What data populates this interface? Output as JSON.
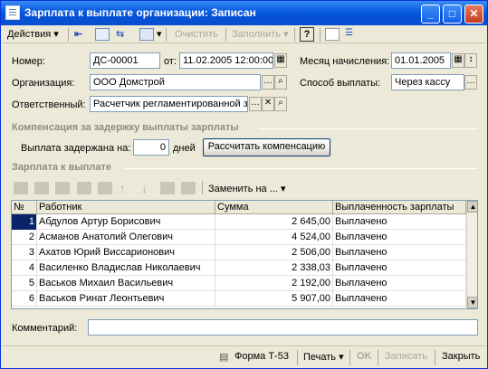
{
  "window": {
    "title": "Зарплата к выплате организации: Записан"
  },
  "toolbar": {
    "actions_label": "Действия",
    "clear_label": "Очистить",
    "fill_label": "Заполнить",
    "help_label": "?"
  },
  "form": {
    "number_label": "Номер:",
    "number_value": "ДС-00001",
    "from_label": "от:",
    "date_value": "11.02.2005 12:00:00",
    "month_label": "Месяц начисления:",
    "month_value": "01.01.2005",
    "org_label": "Организация:",
    "org_value": "ООО Домстрой",
    "payment_label": "Способ выплаты:",
    "payment_value": "Через кассу",
    "responsible_label": "Ответственный:",
    "responsible_value": "Расчетчик регламентированной з"
  },
  "compensation": {
    "section_title": "Компенсация за задержку выплаты зарплаты",
    "delay_label": "Выплата задержана на:",
    "delay_value": "0",
    "days_label": "дней",
    "calc_button": "Рассчитать компенсацию"
  },
  "payout": {
    "section_title": "Зарплата к выплате",
    "replace_label": "Заменить на ...",
    "columns": [
      "№",
      "Работник",
      "Сумма",
      "Выплаченность зарплаты"
    ],
    "rows": [
      {
        "n": "1",
        "worker": "Абдулов Артур Борисович",
        "sum": "2 645,00",
        "status": "Выплачено"
      },
      {
        "n": "2",
        "worker": "Асманов Анатолий Олегович",
        "sum": "4 524,00",
        "status": "Выплачено"
      },
      {
        "n": "3",
        "worker": "Ахатов Юрий Виссарионович",
        "sum": "2 506,00",
        "status": "Выплачено"
      },
      {
        "n": "4",
        "worker": "Василенко Владислав Николаевич",
        "sum": "2 338,03",
        "status": "Выплачено"
      },
      {
        "n": "5",
        "worker": "Васьков Михаил Васильевич",
        "sum": "2 192,00",
        "status": "Выплачено"
      },
      {
        "n": "6",
        "worker": "Васьков Ринат Леонтьевич",
        "sum": "5 907,00",
        "status": "Выплачено"
      }
    ]
  },
  "comment": {
    "label": "Комментарий:",
    "value": ""
  },
  "statusbar": {
    "form_label": "Форма Т-53",
    "print_label": "Печать",
    "ok_label": "OK",
    "save_label": "Записать",
    "close_label": "Закрыть"
  },
  "colors": {
    "titlebar": "#0a5fe0",
    "selection": "#0a246a",
    "window_bg": "#ece9d8"
  }
}
